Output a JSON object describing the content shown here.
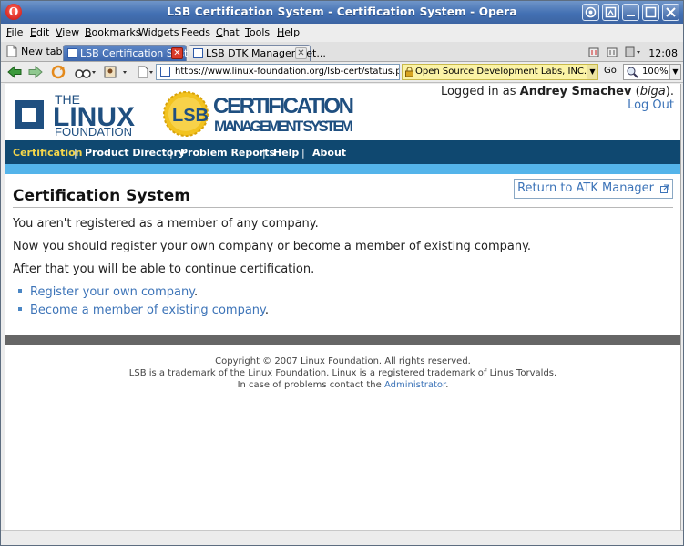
{
  "window": {
    "title": "LSB Certification System - Certification System - Opera",
    "app_icon": "opera-icon",
    "controls": [
      "opera-menu-icon",
      "restore-icon",
      "minimize-icon",
      "maximize-icon",
      "close-icon"
    ]
  },
  "menubar": {
    "items": [
      {
        "label": "File",
        "accel": "F",
        "rest": "ile"
      },
      {
        "label": "Edit",
        "accel": "E",
        "rest": "dit"
      },
      {
        "label": "View",
        "accel": "V",
        "rest": "iew"
      },
      {
        "label": "Bookmarks",
        "accel": "B",
        "rest": "ookmarks"
      },
      {
        "label": "Widgets",
        "accel": "",
        "rest": "Widgets"
      },
      {
        "label": "Feeds",
        "accel": "",
        "rest": "Feeds"
      },
      {
        "label": "Chat",
        "accel": "C",
        "rest": "hat"
      },
      {
        "label": "Tools",
        "accel": "T",
        "rest": "ools"
      },
      {
        "label": "Help",
        "accel": "H",
        "rest": "elp"
      }
    ]
  },
  "tabs": {
    "new_tab": "New tab",
    "items": [
      {
        "label": "LSB Certification Syst...",
        "active": true
      },
      {
        "label": "LSB DTK Manager Get...",
        "active": false
      }
    ],
    "clock": "12:08"
  },
  "toolbar": {
    "url": "https://www.linux-foundation.org/lsb-cert/status.php",
    "certificate": "Open Source Development Labs, INC. (US)",
    "go_label": "Go",
    "zoom": "100%"
  },
  "header": {
    "logged_in_prefix": "Logged in as ",
    "user_name": "Andrey Smachev",
    "user_login": "biga",
    "logout": "Log Out",
    "linux_logo_the": "THE",
    "linux_logo_linux": "LINUX",
    "linux_logo_foundation": "FOUNDATION",
    "lsb_badge": "LSB",
    "lsb_title_line1": "CERTIFICATION",
    "lsb_title_line2": "MANAGEMENT SYSTEM"
  },
  "nav": {
    "items": [
      "Certification",
      "Product Directory",
      "Problem Reports",
      "Help",
      "About"
    ],
    "separator": "|",
    "active_color": "#f5d64a"
  },
  "main": {
    "title": "Certification System",
    "return_button": "Return to ATK Manager",
    "line1": "You aren't registered as a member of any company.",
    "line2": "Now you should register your own company or become a member of existing company.",
    "line3": "After that you will be able to continue certification.",
    "links": [
      {
        "label": "Register your own company",
        "suffix": "."
      },
      {
        "label": "Become a member of existing company",
        "suffix": "."
      }
    ]
  },
  "footer": {
    "line1": "Copyright © 2007 Linux Foundation. All rights reserved.",
    "line2": "LSB is a trademark of the Linux Foundation. Linux is a registered trademark of Linus Torvalds.",
    "line3_prefix": "In case of problems contact the ",
    "line3_link": "Administrator",
    "line3_suffix": "."
  },
  "colors": {
    "nav_bg": "#0f4870",
    "nav_stripe": "#54b4ea",
    "link": "#3d74b8",
    "titlebar": "#4370b3"
  }
}
